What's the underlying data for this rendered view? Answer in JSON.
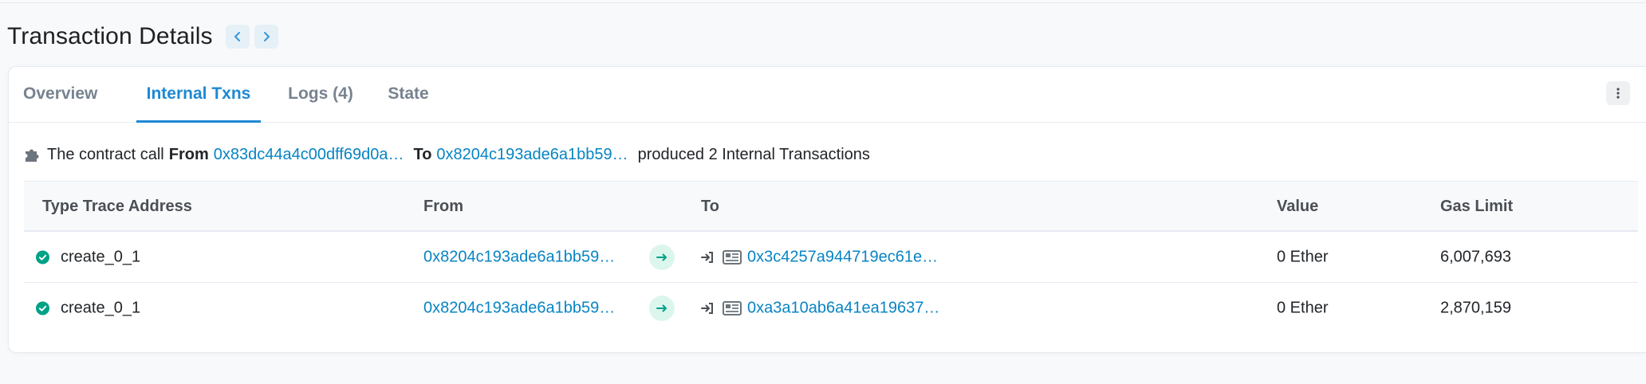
{
  "page": {
    "title": "Transaction Details"
  },
  "tabs": [
    {
      "label": "Overview",
      "active": false
    },
    {
      "label": "Internal Txns",
      "active": true
    },
    {
      "label": "Logs (4)",
      "active": false
    },
    {
      "label": "State",
      "active": false
    }
  ],
  "summary": {
    "prefix": "The contract call",
    "from_label": "From",
    "from_address": "0x83dc44a4c00dff69d0a…",
    "to_label": "To",
    "to_address": "0x8204c193ade6a1bb59…",
    "suffix": "produced 2 Internal Transactions"
  },
  "table": {
    "headers": [
      "Type Trace Address",
      "From",
      "To",
      "Value",
      "Gas Limit"
    ],
    "rows": [
      {
        "status": "success",
        "type": "create_0_1",
        "from": "0x8204c193ade6a1bb59…",
        "to": "0x3c4257a944719ec61e…",
        "value": "0 Ether",
        "gas_limit": "6,007,693"
      },
      {
        "status": "success",
        "type": "create_0_1",
        "from": "0x8204c193ade6a1bb59…",
        "to": "0xa3a10ab6a41ea19637…",
        "value": "0 Ether",
        "gas_limit": "2,870,159"
      }
    ]
  },
  "icons": {
    "prev": "chevron-left-icon",
    "next": "chevron-right-icon",
    "more": "more-vertical-icon",
    "summary": "puzzle-icon",
    "status": "check-circle-icon",
    "direction": "arrow-right-icon",
    "entry": "sign-in-icon",
    "contract": "contract-icon"
  },
  "colors": {
    "link": "#0784c3",
    "tab_active": "#1e88d4",
    "success": "#00a186",
    "arrow_bg": "#dcf6ee",
    "nav_bg": "#e6f0f7"
  }
}
